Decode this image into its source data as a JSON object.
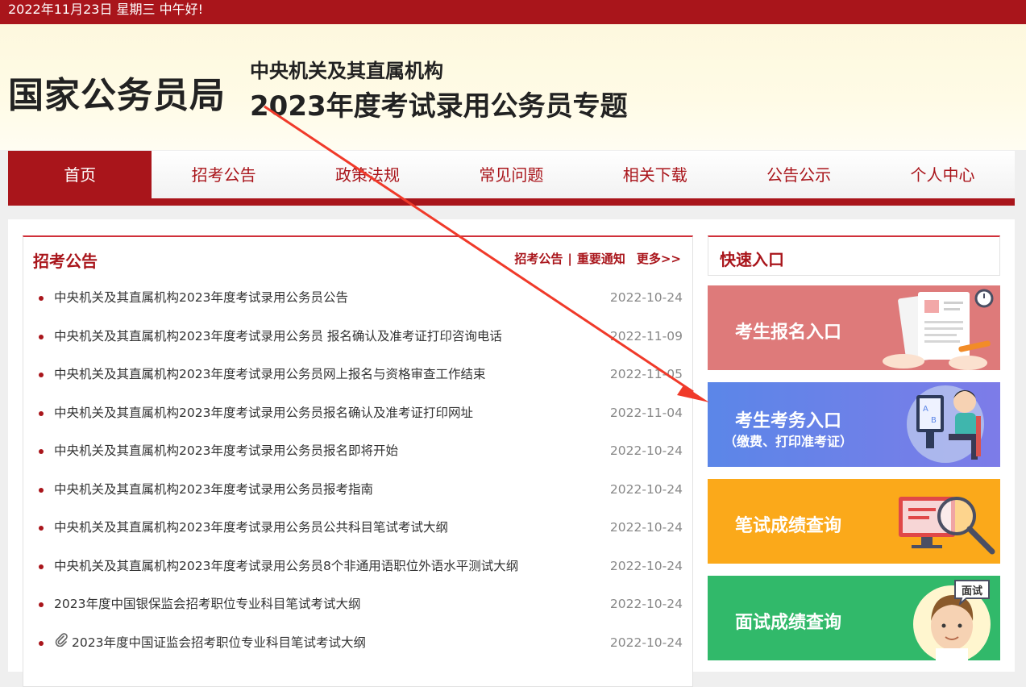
{
  "topbar": {
    "greeting": "2022年11月23日  星期三  中午好!"
  },
  "header": {
    "site_name": "国家公务员局",
    "subtitle": "中央机关及其直属机构",
    "title": "2023年度考试录用公务员专题"
  },
  "nav": {
    "items": [
      {
        "label": "首页",
        "active": true
      },
      {
        "label": "招考公告"
      },
      {
        "label": "政策法规"
      },
      {
        "label": "常见问题"
      },
      {
        "label": "相关下载"
      },
      {
        "label": "公告公示"
      },
      {
        "label": "个人中心"
      }
    ]
  },
  "notice": {
    "title": "招考公告",
    "link_notices": "招考公告",
    "separator": "|",
    "link_important": "重要通知",
    "more": "更多>>",
    "items": [
      {
        "title": "中央机关及其直属机构2023年度考试录用公务员公告",
        "date": "2022-10-24"
      },
      {
        "title": "中央机关及其直属机构2023年度考试录用公务员 报名确认及准考证打印咨询电话",
        "date": "2022-11-09"
      },
      {
        "title": "中央机关及其直属机构2023年度考试录用公务员网上报名与资格审查工作结束",
        "date": "2022-11-05"
      },
      {
        "title": "中央机关及其直属机构2023年度考试录用公务员报名确认及准考证打印网址",
        "date": "2022-11-04"
      },
      {
        "title": "中央机关及其直属机构2023年度考试录用公务员报名即将开始",
        "date": "2022-10-24"
      },
      {
        "title": "中央机关及其直属机构2023年度考试录用公务员报考指南",
        "date": "2022-10-24"
      },
      {
        "title": "中央机关及其直属机构2023年度考试录用公务员公共科目笔试考试大纲",
        "date": "2022-10-24"
      },
      {
        "title": "中央机关及其直属机构2023年度考试录用公务员8个非通用语职位外语水平测试大纲",
        "date": "2022-10-24"
      },
      {
        "title": "2023年度中国银保监会招考职位专业科目笔试考试大纲",
        "date": "2022-10-24"
      },
      {
        "title": "2023年度中国证监会招考职位专业科目笔试考试大纲",
        "date": "2022-10-24",
        "attachment_icon": "paperclip-icon"
      }
    ]
  },
  "quick": {
    "title": "快速入口",
    "entries": [
      {
        "label": "考生报名入口",
        "color": "#de7a7a"
      },
      {
        "label": "考生考务入口",
        "sub": "（缴费、打印准考证）",
        "color": "#6a82e8"
      },
      {
        "label": "笔试成绩查询",
        "color": "#fba91a"
      },
      {
        "label": "面试成绩查询",
        "badge": "面试",
        "color": "#31b96a"
      }
    ]
  },
  "colors": {
    "brand": "#a9151b",
    "annotation_arrow": "#f03a2a"
  }
}
